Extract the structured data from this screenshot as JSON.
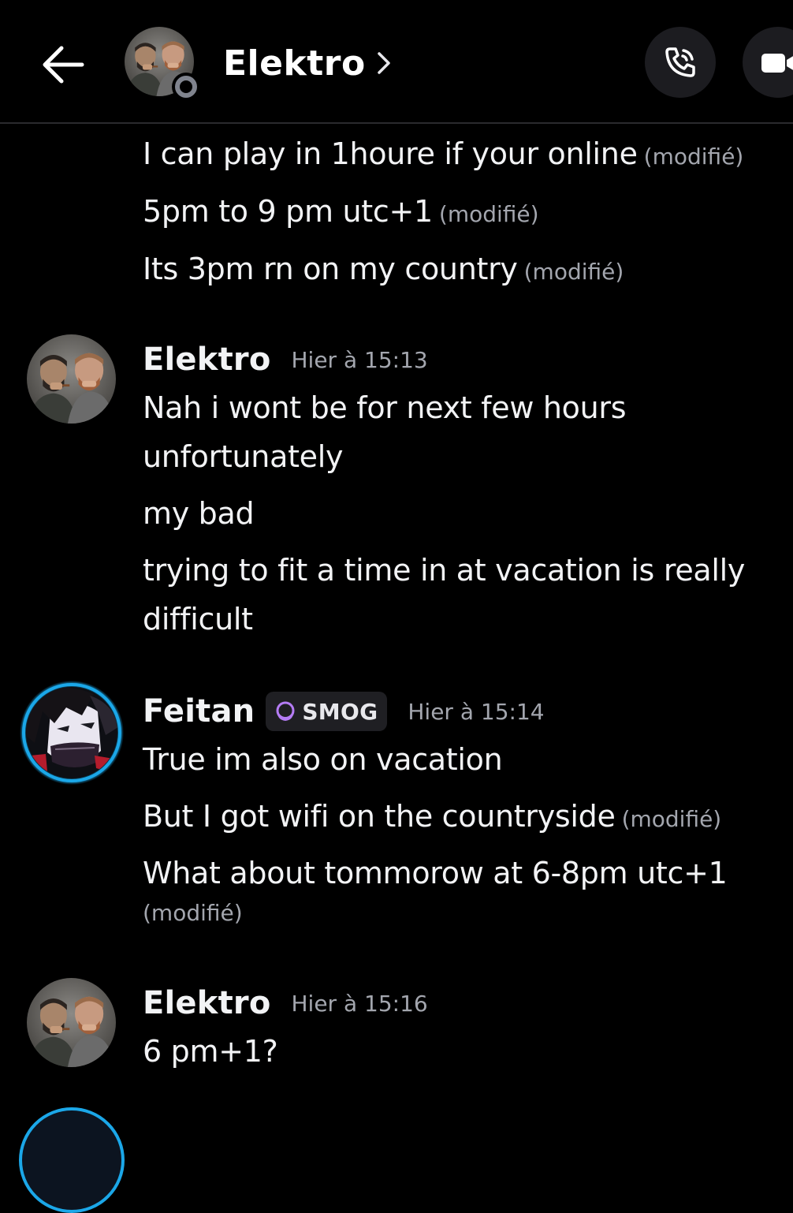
{
  "header": {
    "title": "Elektro",
    "back_icon": "arrow-left-icon",
    "chevron_icon": "chevron-right-icon",
    "call_icon": "phone-icon",
    "video_icon": "video-camera-icon",
    "status": "offline",
    "accent_bg": "#1c1c20"
  },
  "messages": {
    "continued": [
      {
        "text": "I can play in 1houre if your online",
        "edited": "(modifié)"
      },
      {
        "text": "5pm to 9 pm utc+1",
        "edited": "(modifié)"
      },
      {
        "text": "Its 3pm rn on my country",
        "edited": "(modifié)"
      }
    ],
    "groups": [
      {
        "author": "Elektro",
        "timestamp": "Hier à 15:13",
        "lines": [
          {
            "text": "Nah i wont be for next few hours unfortunately"
          },
          {
            "text": "my bad"
          },
          {
            "text": "trying to fit a time in at vacation is really difficult"
          }
        ]
      },
      {
        "author": "Feitan",
        "tag": "SMOG",
        "tag_icon": "moon-icon",
        "tag_color": "#b57cf5",
        "avatar_ring_color": "#1ba7e8",
        "timestamp": "Hier à 15:14",
        "lines": [
          {
            "text": "True im also on vacation"
          },
          {
            "text": "But I got wifi on the countryside",
            "edited": "(modifié)"
          },
          {
            "text": "What about tommorow at 6-8pm utc+1",
            "edited": "(modifié)"
          }
        ]
      },
      {
        "author": "Elektro",
        "timestamp": "Hier à 15:16",
        "lines": [
          {
            "text": "6 pm+1?"
          }
        ]
      }
    ]
  }
}
